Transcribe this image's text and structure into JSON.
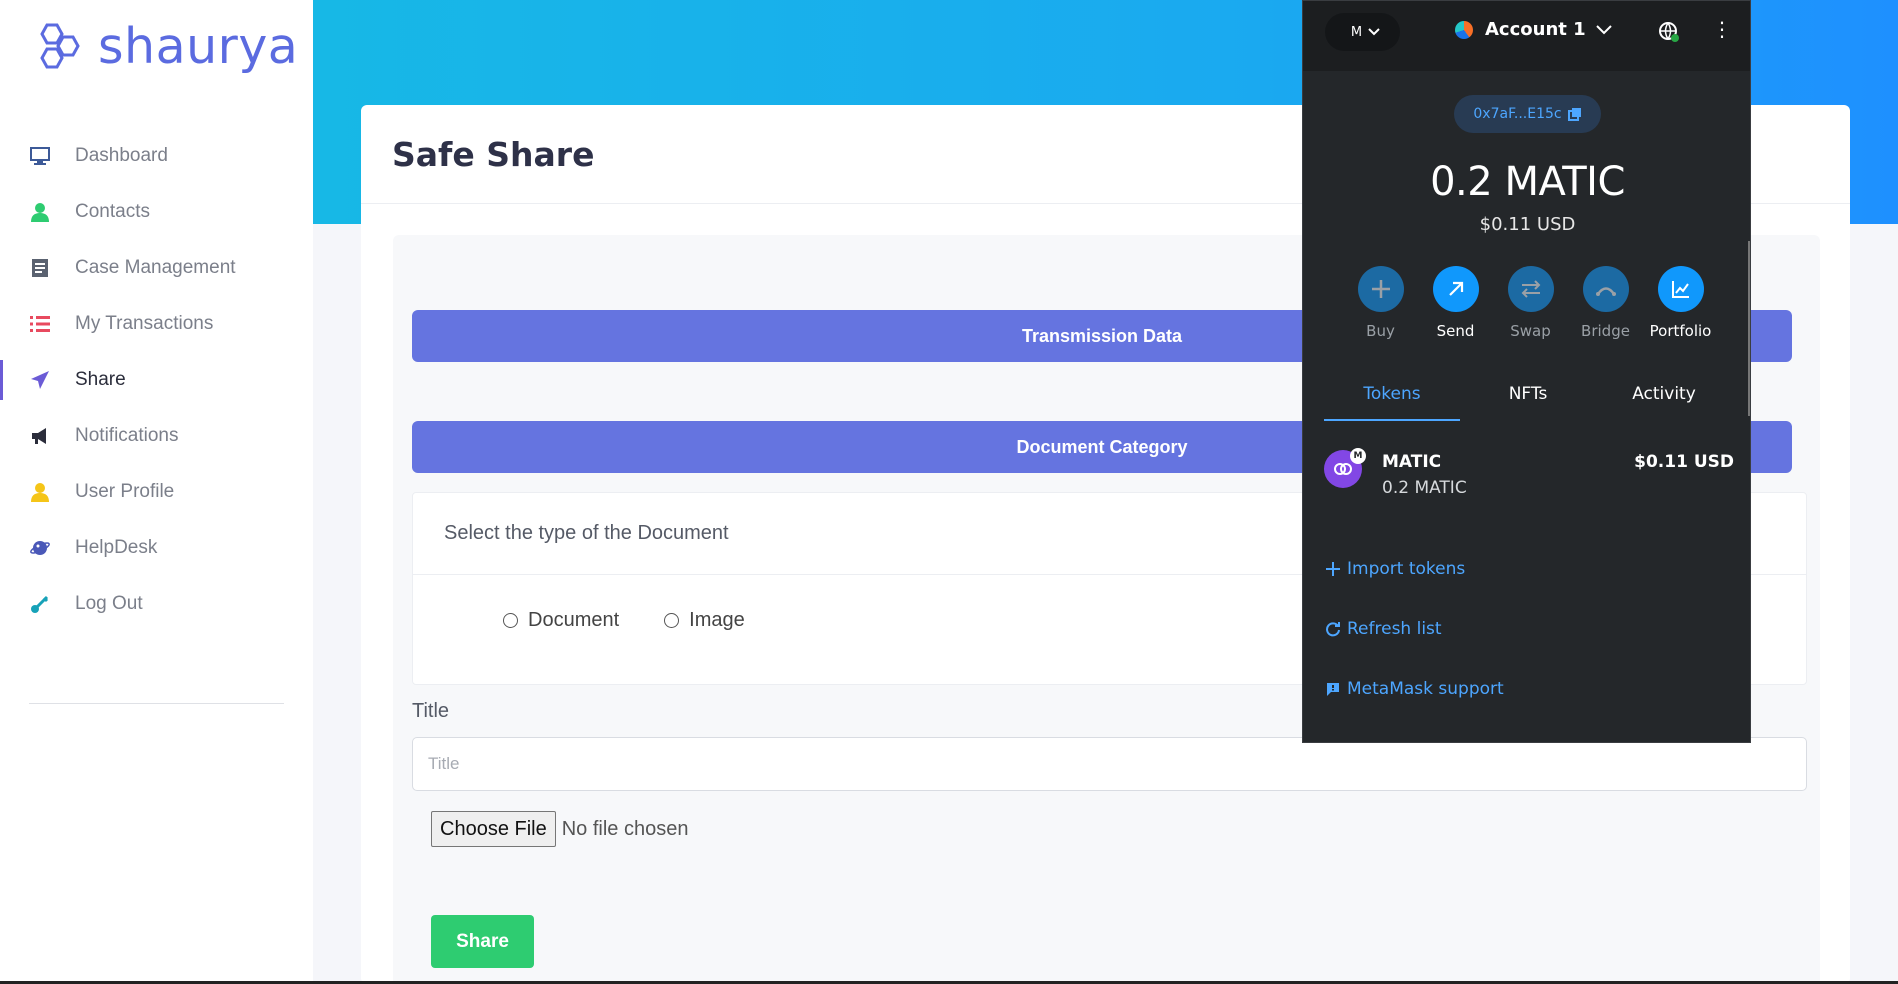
{
  "brand": {
    "name": "shaurya"
  },
  "sidebar": {
    "items": [
      {
        "label": "Dashboard",
        "icon": "monitor-icon"
      },
      {
        "label": "Contacts",
        "icon": "person-icon"
      },
      {
        "label": "Case Management",
        "icon": "document-icon"
      },
      {
        "label": "My Transactions",
        "icon": "list-icon"
      },
      {
        "label": "Share",
        "icon": "paper-plane-icon",
        "active": true
      },
      {
        "label": "Notifications",
        "icon": "megaphone-icon"
      },
      {
        "label": "User Profile",
        "icon": "user-icon"
      },
      {
        "label": "HelpDesk",
        "icon": "planet-icon"
      },
      {
        "label": "Log Out",
        "icon": "key-icon"
      }
    ]
  },
  "page": {
    "title": "Safe Share",
    "transmission_band": "Transmission Data",
    "document_band": "Document Category",
    "doc_type_prompt": "Select the type of the Document",
    "radio_document": "Document",
    "radio_image": "Image",
    "title_label": "Title",
    "title_placeholder": "Title",
    "file_button": "Choose File",
    "file_status": "No file chosen",
    "share_button": "Share"
  },
  "metamask": {
    "network_letter": "M",
    "account_name": "Account 1",
    "address": "0x7aF...E15c",
    "balance": "0.2 MATIC",
    "balance_usd": "$0.11 USD",
    "actions": [
      {
        "label": "Buy",
        "icon": "plus-icon",
        "enabled": false
      },
      {
        "label": "Send",
        "icon": "arrow-up-right-icon",
        "enabled": true
      },
      {
        "label": "Swap",
        "icon": "swap-arrows-icon",
        "enabled": false
      },
      {
        "label": "Bridge",
        "icon": "bridge-icon",
        "enabled": false
      },
      {
        "label": "Portfolio",
        "icon": "chart-icon",
        "enabled": true
      }
    ],
    "tabs": [
      {
        "label": "Tokens",
        "active": true
      },
      {
        "label": "NFTs",
        "active": false
      },
      {
        "label": "Activity",
        "active": false
      }
    ],
    "token": {
      "name": "MATIC",
      "amount": "0.2 MATIC",
      "usd": "$0.11 USD",
      "badge": "M"
    },
    "links": {
      "import": "Import tokens",
      "refresh": "Refresh list",
      "support": "MetaMask support"
    },
    "accent_color": "#4da6ff"
  }
}
